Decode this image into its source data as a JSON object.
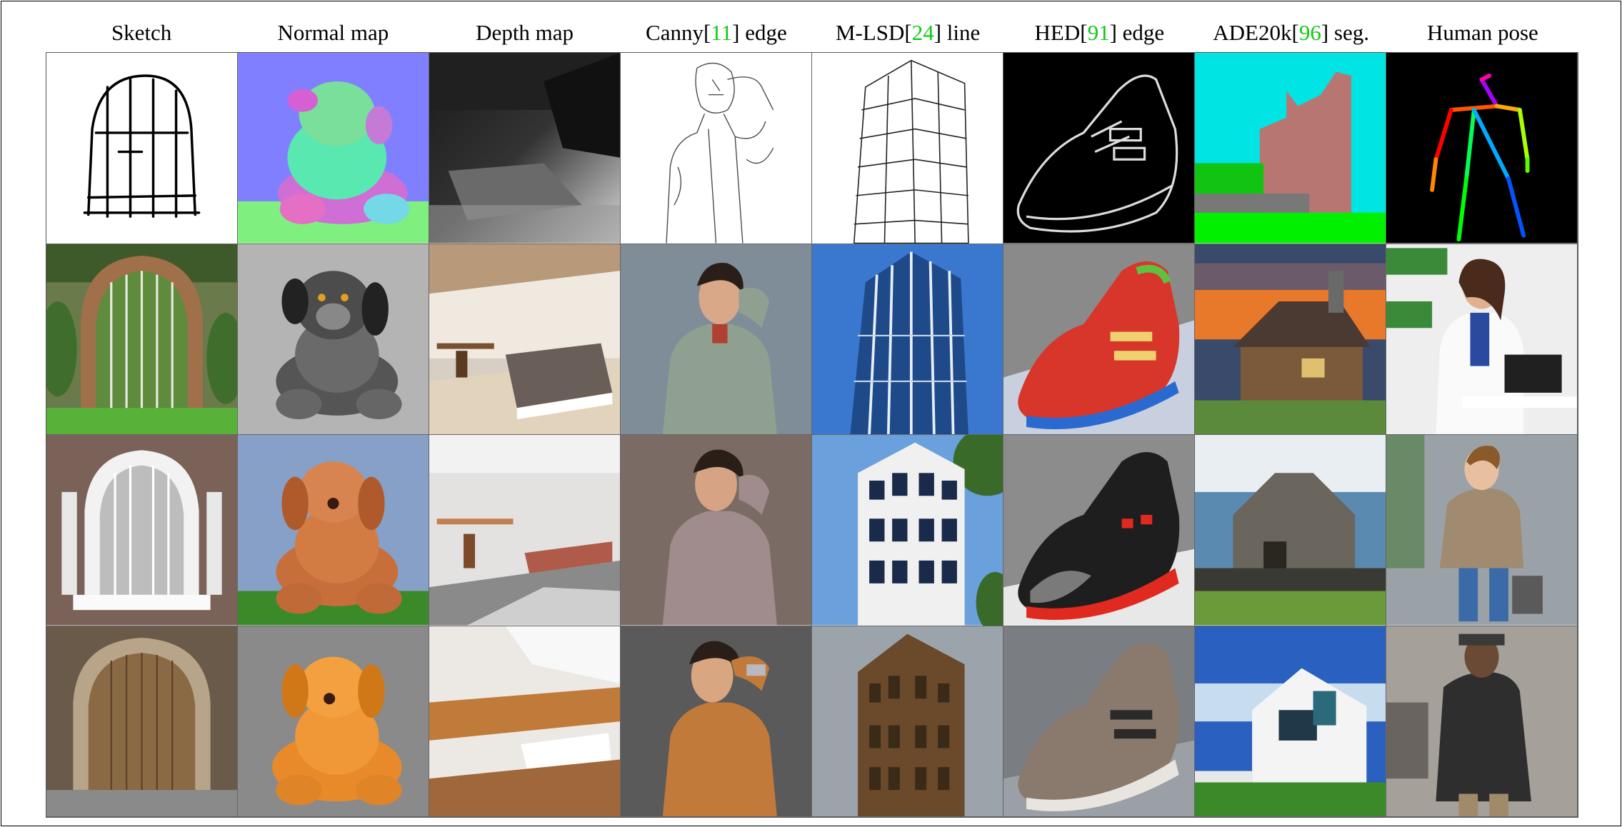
{
  "headers": [
    {
      "pre": "Sketch",
      "ref": "",
      "post": ""
    },
    {
      "pre": "Normal map",
      "ref": "",
      "post": ""
    },
    {
      "pre": "Depth map",
      "ref": "",
      "post": ""
    },
    {
      "pre": "Canny[",
      "ref": "11",
      "post": "] edge"
    },
    {
      "pre": "M-LSD[",
      "ref": "24",
      "post": "] line"
    },
    {
      "pre": "HED[",
      "ref": "91",
      "post": "] edge"
    },
    {
      "pre": "ADE20k[",
      "ref": "96",
      "post": "] seg."
    },
    {
      "pre": "Human pose",
      "ref": "",
      "post": ""
    }
  ],
  "colors": {
    "citation": "#12c912",
    "grid_line": "#666666"
  },
  "cells": [
    [
      "sketch-arch-door",
      "normal-map-plush-animal",
      "depth-map-room",
      "canny-edge-man",
      "mlsd-line-tower",
      "hed-edge-shoe",
      "ade20k-seg-house",
      "human-pose-skeleton"
    ],
    [
      "generated-garden-arch-gate",
      "generated-gray-plush-lamb",
      "generated-bedroom-1",
      "generated-man-gray-shirt",
      "generated-blue-glass-tower",
      "generated-red-sneaker",
      "generated-cottage-sunset",
      "generated-woman-office"
    ],
    [
      "generated-arched-window",
      "generated-brown-plush-puppy",
      "generated-bedroom-2",
      "generated-man-lilac-shirt",
      "generated-white-office-tower",
      "generated-black-red-sneaker",
      "generated-stone-church",
      "generated-boy-jacket"
    ],
    [
      "generated-wooden-arch-door",
      "generated-orange-plush-bear",
      "generated-bedroom-3",
      "generated-man-orange-shirt",
      "generated-ornate-tower",
      "generated-gray-sneaker",
      "generated-modern-house",
      "generated-man-black-coat"
    ]
  ]
}
